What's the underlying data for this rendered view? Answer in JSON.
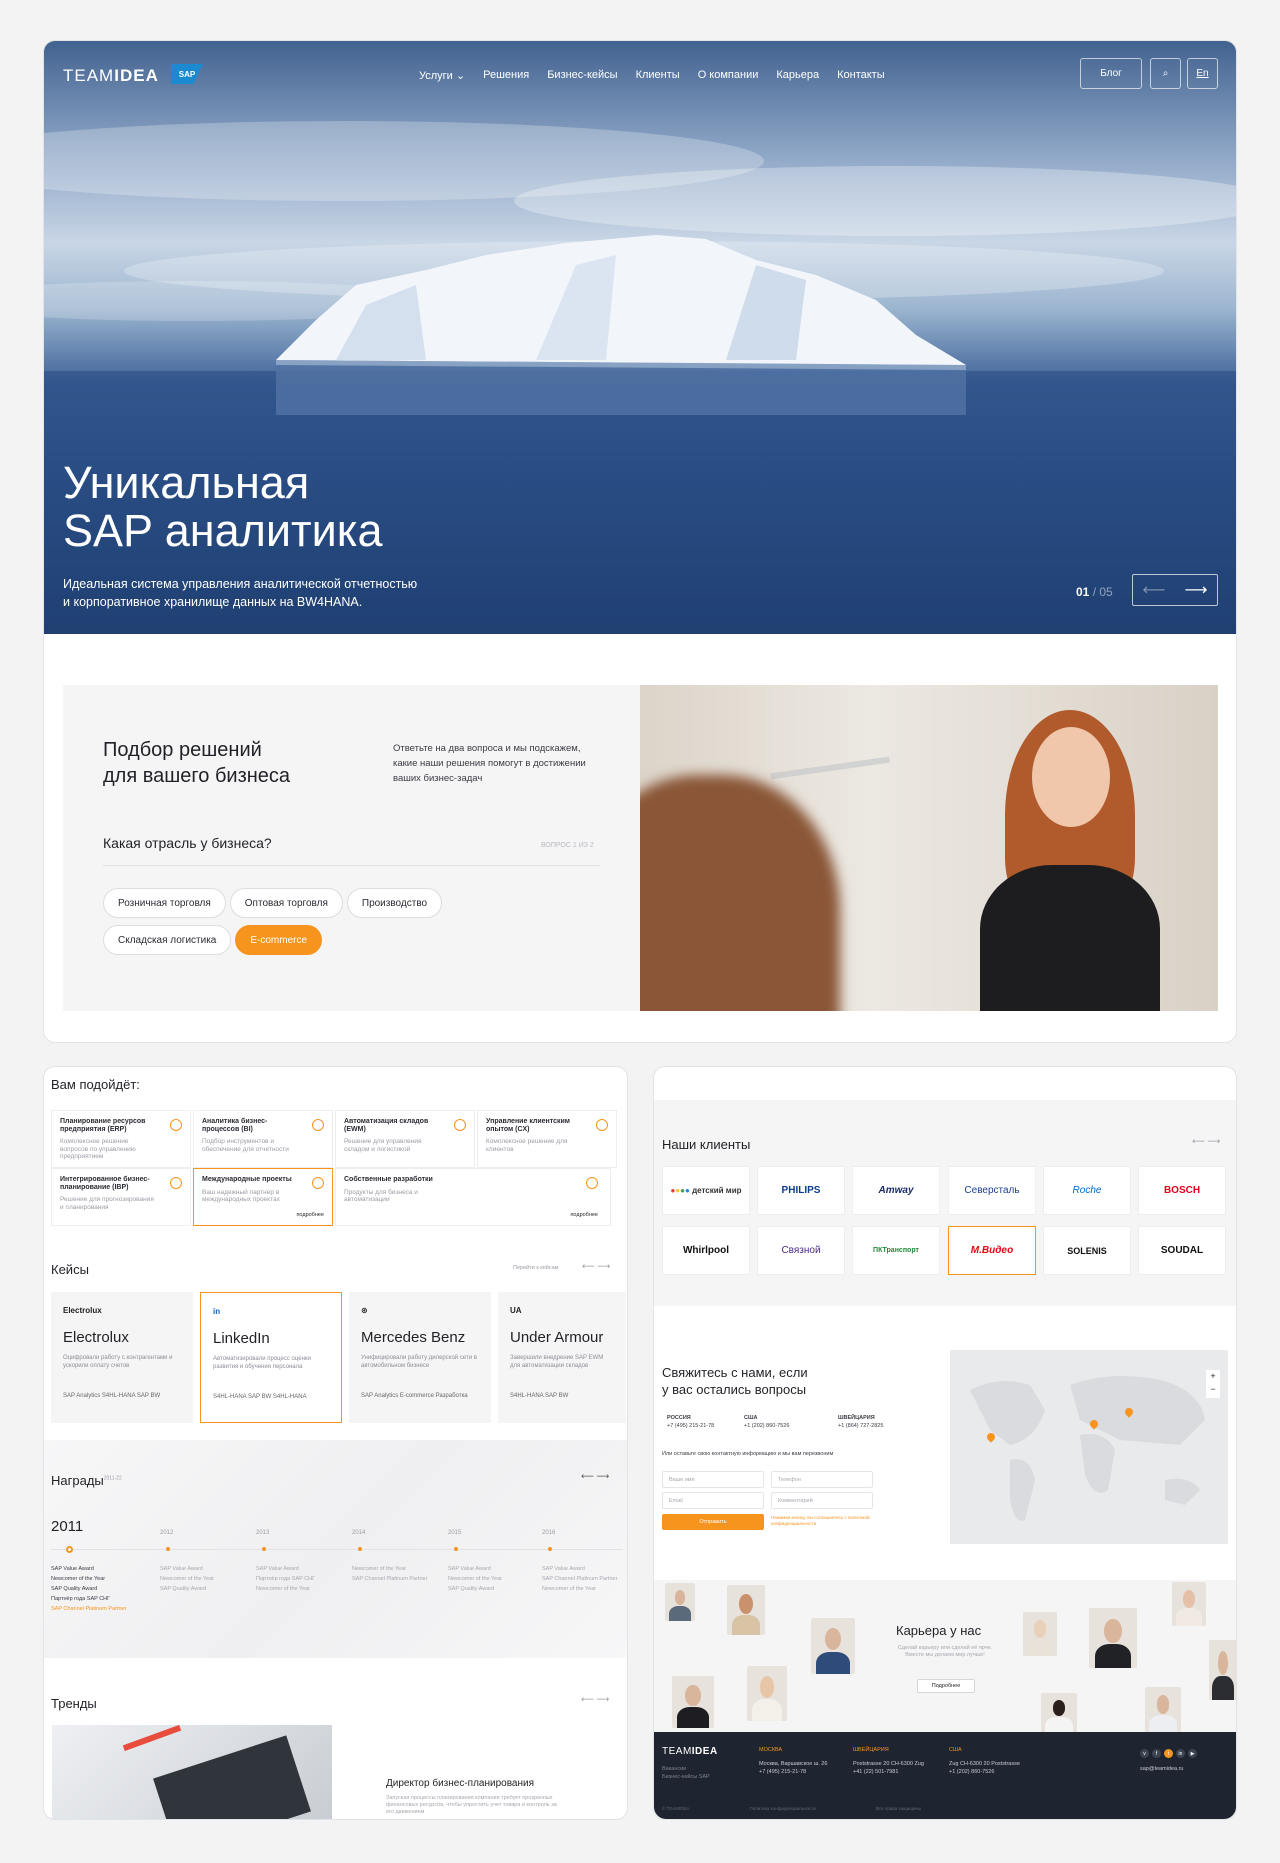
{
  "nav": {
    "logo": "TEAMIDEA",
    "logo_a": "TEAM",
    "logo_b": "IDEA",
    "sap": "SAP",
    "menu": [
      "Услуги",
      "Решения",
      "Бизнес-кейсы",
      "Клиенты",
      "О компании",
      "Карьера",
      "Контакты"
    ],
    "blog": "Блог",
    "lang": "En"
  },
  "hero": {
    "title_1": "Уникальная",
    "title_2": "SAP аналитика",
    "subtitle_1": "Идеальная система управления аналитической отчетностью",
    "subtitle_2": "и корпоративное хранилище данных на BW4HANA.",
    "page_current": "01",
    "page_total": "/ 05"
  },
  "quiz": {
    "title_1": "Подбор решений",
    "title_2": "для вашего бизнеса",
    "intro": "Ответьте на два вопроса и мы подскажем, какие наши решения помогут в достижении ваших бизнес-задач",
    "question": "Какая отрасль у бизнеса?",
    "step": "ВОПРОС 1 ИЗ 2",
    "options": [
      "Розничная торговля",
      "Оптовая торговля",
      "Производство",
      "Складская логистика",
      "E-commerce"
    ],
    "selected": "E-commerce"
  },
  "fit": {
    "title": "Вам подойдёт:",
    "services": [
      {
        "title": "Планирование ресурсов предприятия (ERP)",
        "desc": "Комплексное решение вопросов по управлению предприятием"
      },
      {
        "title": "Аналитика бизнес-процессов (BI)",
        "desc": "Подбор инструментов и обеспечение для отчетности"
      },
      {
        "title": "Автоматизация складов (EWM)",
        "desc": "Решение для управления складом и логистикой"
      },
      {
        "title": "Управление клиентским опытом (CX)",
        "desc": "Комплексное решение для клиентов"
      },
      {
        "title": "Интегрированное бизнес-планирование (IBP)",
        "desc": "Решение для прогнозирования и планирования"
      },
      {
        "title": "Международные проекты",
        "desc": "Ваш надежный партнер в международных проектах"
      },
      {
        "title": "Собственные разработки",
        "desc": "Продукты для бизнеса и автоматизации"
      },
      {
        "title": "",
        "desc": ""
      }
    ],
    "more": "подробнее"
  },
  "cases": {
    "title": "Кейсы",
    "all": "Перейти к кейсам",
    "items": [
      {
        "logo": "Electrolux",
        "name": "Electrolux",
        "desc": "Оцифровали работу с контрагентами и ускорили оплату счетов",
        "tags": "SAP Analytics  S4HL-HANA  SAP BW"
      },
      {
        "logo": "in",
        "name": "LinkedIn",
        "desc": "Автоматизировали процесс оценки развития и обучения персонала",
        "tags": "S4HL-HANA  SAP BW  S4HL-HANA"
      },
      {
        "logo": "Mercedes",
        "name": "Mercedes Benz",
        "desc": "Унифицировали работу дилерской сети в автомобильном бизнесе",
        "tags": "SAP Analytics  E-commerce  Разработка"
      },
      {
        "logo": "UA",
        "name": "Under Armour",
        "desc": "Завершили внедрение SAP EWM для автоматизации складов",
        "tags": "S4HL-HANA  SAP BW"
      }
    ]
  },
  "awards": {
    "title": "Награды",
    "sup": "2011-22",
    "current": "2011",
    "years": [
      "2012",
      "2013",
      "2014",
      "2015",
      "2016"
    ],
    "list": [
      "SAP Value Award",
      "Newcomer of the Year",
      "SAP Quality Award",
      "Партнёр года SAP СНГ",
      "SAP Channel Platinum Partner"
    ],
    "cols": [
      [
        "SAP Value Award",
        "Newcomer of the Year",
        "SAP Quality Award"
      ],
      [
        "SAP Value Award",
        "Партнёр года SAP СНГ",
        "Newcomer of the Year"
      ],
      [
        "Newcomer of the Year",
        "SAP Channel Platinum Partner"
      ],
      [
        "SAP Value Award",
        "Newcomer of the Year",
        "SAP Quality Award"
      ],
      [
        "SAP Value Award",
        "SAP Channel Platinum Partner",
        "Newcomer of the Year"
      ]
    ]
  },
  "trends": {
    "title": "Тренды",
    "article": "Директор бизнес-планирования",
    "excerpt": "Запуская процессы планирования компания требует прозрачных финансовых ресурсов, чтобы упростить учет товара и контроль за его движением"
  },
  "clients": {
    "title": "Наши клиенты",
    "logos": [
      "детский мир",
      "PHILIPS",
      "Amway",
      "Северсталь",
      "Roche",
      "BOSCH",
      "Whirlpool",
      "Связной",
      "ПКТранспорт",
      "М.Видео",
      "SOLENIS",
      "SOUDAL"
    ]
  },
  "contact": {
    "title_1": "Свяжитесь с нами, если",
    "title_2": "у вас остались вопросы",
    "offices": [
      {
        "country": "РОССИЯ",
        "phone": "+7 (495) 215-21-78"
      },
      {
        "country": "США",
        "phone": "+1 (202) 860-7526"
      },
      {
        "country": "ШВЕЙЦАРИЯ",
        "phone": "+1 (864) 727-2825"
      }
    ],
    "note": "Или оставьте свою контактную информацию и мы вам перезвоним",
    "name": "Ваше имя",
    "phone": "Телефон",
    "email": "Email",
    "comment": "Комментарий",
    "submit": "Отправить",
    "consent": "Нажимая кнопку, вы соглашаетесь с политикой конфиденциальности",
    "zoom_in": "+",
    "zoom_out": "−"
  },
  "career": {
    "title": "Карьера у нас",
    "desc": "Сделай карьеру или сделай её ярче. Вместе мы делаем мир лучше!",
    "btn": "Подробнее"
  },
  "footer": {
    "logo_a": "TEAM",
    "logo_b": "IDEA",
    "links": [
      "Вакансии",
      "Бизнес-кейсы SAP"
    ],
    "cols": [
      {
        "h": "МОСКВА",
        "a": "Москва, Варшавское ш. 26",
        "p": "+7 (495) 215-21-78"
      },
      {
        "h": "ШВЕЙЦАРИЯ",
        "a": "Poststrasse 20 CH-6300 Zug",
        "p": "+41 (22) 501-7981"
      },
      {
        "h": "США",
        "a": "Zug CH-6300 20 Poststrasse",
        "p": "+1 (202) 860-7526"
      }
    ],
    "email": "sap@teamidea.ru",
    "copyright": "© TEAMIDEA",
    "policy": "Политика конфиденциальности",
    "rights": "Все права защищены"
  }
}
